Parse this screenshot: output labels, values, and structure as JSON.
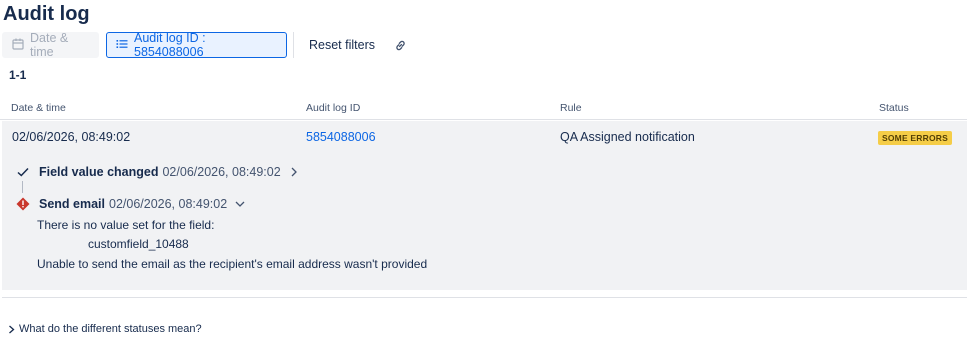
{
  "page": {
    "title": "Audit log"
  },
  "filters": {
    "date_time_label": "Date & time",
    "audit_log_id_label": "Audit log ID : 5854088006",
    "reset_label": "Reset filters",
    "link_icon": "link-icon"
  },
  "results": {
    "range": "1-1"
  },
  "table": {
    "headers": [
      "Date & time",
      "Audit log ID",
      "Rule",
      "Status"
    ],
    "row": {
      "date_time": "02/06/2026, 08:49:02",
      "audit_log_id": "5854088006",
      "rule": "QA Assigned notification",
      "status": "SOME ERRORS"
    }
  },
  "events": [
    {
      "label": "Field value changed",
      "timestamp": "02/06/2026, 08:49:02",
      "icon": "checkmark-icon",
      "expanded": false
    },
    {
      "label": "Send email",
      "timestamp": "02/06/2026, 08:49:02",
      "icon": "error-diamond-icon",
      "expanded": true
    }
  ],
  "details": {
    "line1": "There is no value set for the field:",
    "field": "customfield_10488",
    "line2": "Unable to send the email as the recipient's email address wasn't provided"
  },
  "faq": {
    "label": "What do the different statuses mean?"
  },
  "colors": {
    "accent": "#0c66e4",
    "panel": "#f1f2f4",
    "error": "#c9372c",
    "warning_badge": "#f5cd47"
  }
}
